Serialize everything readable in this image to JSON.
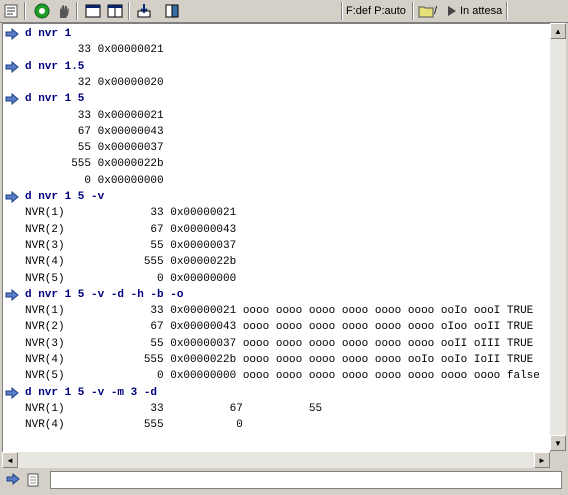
{
  "toolbar": {
    "icons": [
      "properties-icon",
      "run-icon",
      "stop-hand-icon",
      "window-icon",
      "window-split-icon",
      "download-icon",
      "book-icon",
      "folder-icon",
      "play-icon"
    ],
    "format_label": "F:def P:auto",
    "folder_suffix": "/",
    "status_label": "In attesa"
  },
  "console": {
    "lines": [
      {
        "cmd": true,
        "text": "d nvr 1"
      },
      {
        "cmd": false,
        "text": "        33 0x00000021"
      },
      {
        "cmd": true,
        "text": "d nvr 1.5"
      },
      {
        "cmd": false,
        "text": "        32 0x00000020"
      },
      {
        "cmd": true,
        "text": "d nvr 1 5"
      },
      {
        "cmd": false,
        "text": "        33 0x00000021"
      },
      {
        "cmd": false,
        "text": "        67 0x00000043"
      },
      {
        "cmd": false,
        "text": "        55 0x00000037"
      },
      {
        "cmd": false,
        "text": "       555 0x0000022b"
      },
      {
        "cmd": false,
        "text": "         0 0x00000000"
      },
      {
        "cmd": true,
        "text": "d nvr 1 5 -v"
      },
      {
        "cmd": false,
        "text": "NVR(1)             33 0x00000021"
      },
      {
        "cmd": false,
        "text": "NVR(2)             67 0x00000043"
      },
      {
        "cmd": false,
        "text": "NVR(3)             55 0x00000037"
      },
      {
        "cmd": false,
        "text": "NVR(4)            555 0x0000022b"
      },
      {
        "cmd": false,
        "text": "NVR(5)              0 0x00000000"
      },
      {
        "cmd": true,
        "text": "d nvr 1 5 -v -d -h -b -o"
      },
      {
        "cmd": false,
        "text": "NVR(1)             33 0x00000021 oooo oooo oooo oooo oooo oooo ooIo oooI TRUE"
      },
      {
        "cmd": false,
        "text": "NVR(2)             67 0x00000043 oooo oooo oooo oooo oooo oooo oIoo ooII TRUE"
      },
      {
        "cmd": false,
        "text": "NVR(3)             55 0x00000037 oooo oooo oooo oooo oooo oooo ooII oIII TRUE"
      },
      {
        "cmd": false,
        "text": "NVR(4)            555 0x0000022b oooo oooo oooo oooo oooo ooIo ooIo IoII TRUE"
      },
      {
        "cmd": false,
        "text": "NVR(5)              0 0x00000000 oooo oooo oooo oooo oooo oooo oooo oooo false"
      },
      {
        "cmd": true,
        "text": "d nvr 1 5 -v -m 3 -d"
      },
      {
        "cmd": false,
        "text": "NVR(1)             33          67          55"
      },
      {
        "cmd": false,
        "text": "NVR(4)            555           0"
      }
    ]
  },
  "input": {
    "value": ""
  }
}
